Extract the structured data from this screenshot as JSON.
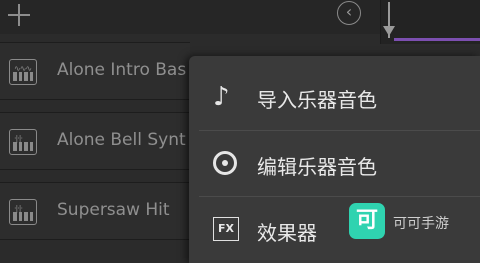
{
  "topbar": {
    "add_icon": "plus-icon",
    "back_icon": "chevron-left-icon"
  },
  "tracks": [
    {
      "name": "Alone Intro Bas",
      "icon": "synth-keyboard-icon"
    },
    {
      "name": "Alone Bell Synt",
      "icon": "synth-keyboard-icon"
    },
    {
      "name": "Supersaw Hit",
      "icon": "synth-keyboard-icon"
    }
  ],
  "menu": {
    "items": [
      {
        "label": "导入乐器音色",
        "icon": "music-note-icon"
      },
      {
        "label": "编辑乐器音色",
        "icon": "knob-icon"
      },
      {
        "label": "效果器",
        "icon": "fx-icon",
        "icon_text": "FX"
      }
    ]
  },
  "watermark": {
    "logo_text": "可",
    "text": "可可手游"
  },
  "colors": {
    "accent_purple": "#7c4fb0",
    "badge": "#2fd3b0"
  }
}
